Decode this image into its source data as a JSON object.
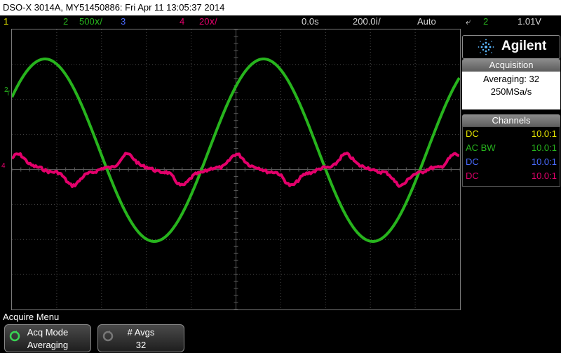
{
  "title_bar": "DSO-X 3014A, MY51450886: Fri Apr 11 13:05:37 2014",
  "status": {
    "ch1_num": "1",
    "ch2_num": "2",
    "ch2_scale": "500ⅹ/",
    "ch3_num": "3",
    "ch4_num": "4",
    "ch4_scale": "20ⅹ/",
    "time_offset": "0.0s",
    "timebase": "200.0ⅰ/",
    "trigger_mode": "Auto",
    "trigger_source": "2",
    "trigger_level": "1.01V"
  },
  "markers": {
    "trig_label": "T",
    "ch2_gnd": "2",
    "ch4_gnd": "4"
  },
  "panel": {
    "brand": "Agilent",
    "acquisition_header": "Acquisition",
    "acq_mode_line": "Averaging: 32",
    "acq_rate": "250MSa/s",
    "channels_header": "Channels",
    "channels": [
      {
        "coupling": "DC",
        "ratio": "10.0:1",
        "color": "#e6e600"
      },
      {
        "coupling": "AC BW",
        "ratio": "10.0:1",
        "color": "#27b41d"
      },
      {
        "coupling": "DC",
        "ratio": "10.0:1",
        "color": "#4a6bff"
      },
      {
        "coupling": "DC",
        "ratio": "10.0:1",
        "color": "#e3006b"
      }
    ]
  },
  "menu": {
    "title": "Acquire Menu",
    "softkeys": [
      {
        "label": "Acq Mode",
        "value": "Averaging"
      },
      {
        "label": "# Avgs",
        "value": "32"
      }
    ]
  },
  "colors": {
    "ch1": "#e6e600",
    "ch2": "#27b41d",
    "ch3": "#4a6bff",
    "ch4": "#e3006b",
    "trigger": "#f28c00"
  },
  "waveform": {
    "ch2_periods_on_screen": 2.05,
    "ch4_periods_on_screen": 4.1
  }
}
